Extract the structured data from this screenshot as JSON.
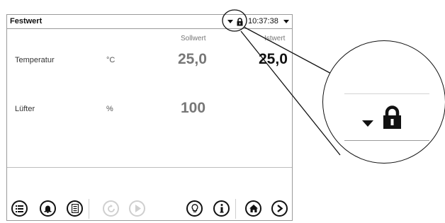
{
  "header": {
    "title": "Festwert",
    "time": "10:37:38"
  },
  "columns": {
    "setpoint": "Sollwert",
    "actual": "Istwert"
  },
  "rows": [
    {
      "label": "Temperatur",
      "unit": "°C",
      "setpoint": "25,0",
      "actual": "25,0"
    },
    {
      "label": "Lüfter",
      "unit": "%",
      "setpoint": "100",
      "actual": ""
    }
  ],
  "icons": {
    "menu": "list-menu-icon",
    "alarm": "alarm-bell-icon",
    "events": "event-list-icon",
    "refresh": "refresh-icon",
    "start": "play-icon",
    "info_tip": "lightbulb-icon",
    "info": "info-icon",
    "home": "home-icon",
    "next": "chevron-right-icon",
    "lock": "lock-icon",
    "dropdown": "dropdown-triangle-icon"
  },
  "colors": {
    "border": "#9a9a9a",
    "disabled": "#cfcfcf",
    "text": "#111111"
  }
}
